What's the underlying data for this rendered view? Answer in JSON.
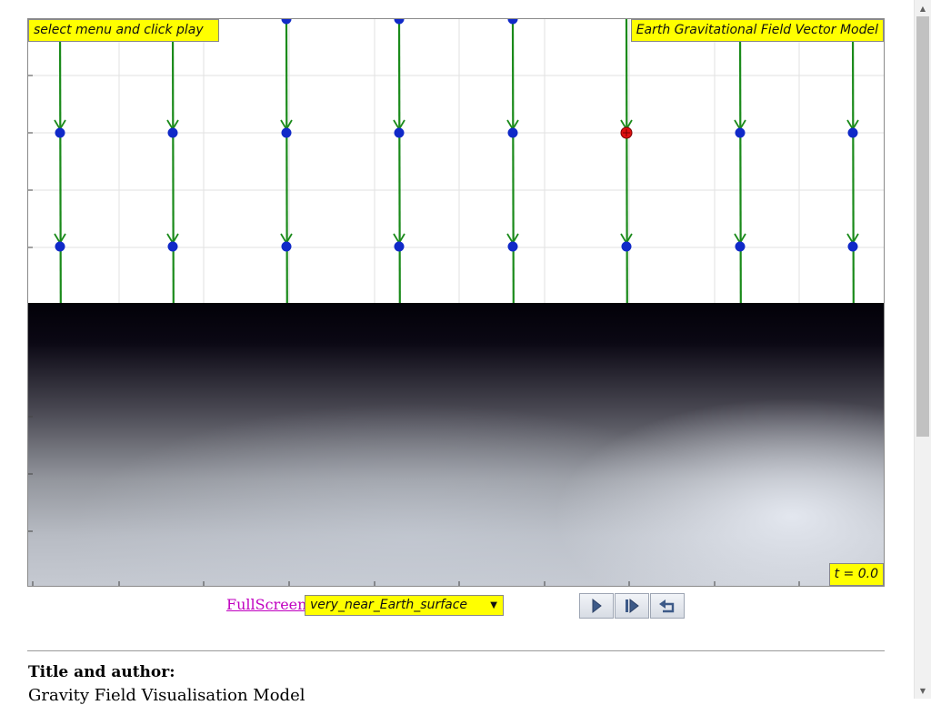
{
  "simulation": {
    "menu_hint": "select menu and click play",
    "title": "Earth Gravitational Field Vector Model",
    "time_readout": "t = 0.0",
    "colors": {
      "field_line": "#1a8a1a",
      "probe": "#1029c8",
      "selected_probe": "#e01010",
      "label_bg": "#ffff00",
      "grid": "#e2e2e2"
    },
    "field_columns": 8,
    "probe_rows": 3,
    "selected_probe": {
      "column": 6,
      "row": 2
    },
    "field_direction": "downward"
  },
  "controls": {
    "fullscreen_link": "FullScreen",
    "model_select": {
      "selected": "very_near_Earth_surface"
    },
    "buttons": [
      {
        "name": "play-button",
        "icon": "play-icon"
      },
      {
        "name": "step-button",
        "icon": "step-forward-icon"
      },
      {
        "name": "reset-button",
        "icon": "reset-icon"
      }
    ]
  },
  "info": {
    "heading": "Title and author:",
    "text": "Gravity Field Visualisation Model"
  }
}
